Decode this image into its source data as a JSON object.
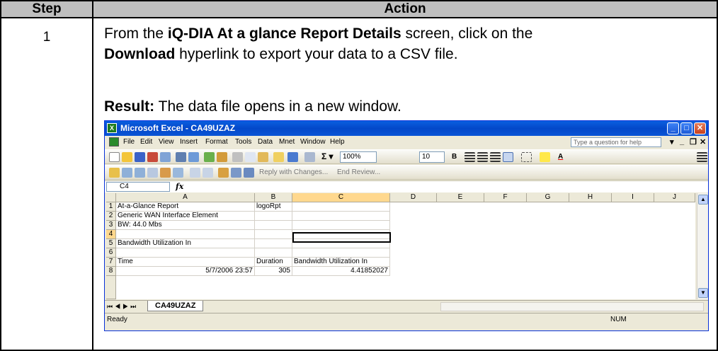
{
  "table": {
    "header_step": "Step",
    "header_action": "Action",
    "step_number": "1",
    "instruction_part1": "From the ",
    "instruction_bold1": "iQ-DIA At a glance Report Details",
    "instruction_part2": " screen, click on the",
    "instruction_bold2": "Download",
    "instruction_part3": " hyperlink to export your data to a CSV file.",
    "result_label": "Result:",
    "result_text": "  The data file opens in a new window."
  },
  "excel": {
    "title": "Microsoft Excel - CA49UZAZ",
    "menu": [
      "File",
      "Edit",
      "View",
      "Insert",
      "Format",
      "Tools",
      "Data",
      "Mnet",
      "Window",
      "Help"
    ],
    "help_placeholder": "Type a question for help",
    "zoom": "100%",
    "font_size": "10",
    "reply_text": "Reply with Changes...",
    "end_review": "End Review...",
    "name_box": "C4",
    "fx": "fx",
    "columns": [
      "A",
      "B",
      "C",
      "D",
      "E",
      "F",
      "G",
      "H",
      "I",
      "J"
    ],
    "rows": [
      {
        "num": "1",
        "A": "At-a-Glance Report",
        "B": "logoRpt",
        "C": ""
      },
      {
        "num": "2",
        "A": "Generic WAN Interface Element",
        "B": "",
        "C": ""
      },
      {
        "num": "3",
        "A": "BW: 44.0 Mbs",
        "B": "",
        "C": ""
      },
      {
        "num": "4",
        "A": "",
        "B": "",
        "C": ""
      },
      {
        "num": "5",
        "A": "Bandwidth Utilization In",
        "B": "",
        "C": ""
      },
      {
        "num": "6",
        "A": "",
        "B": "",
        "C": ""
      },
      {
        "num": "7",
        "A": "Time",
        "B": "Duration",
        "C": "Bandwidth Utilization In"
      },
      {
        "num": "8",
        "A": "5/7/2006 23:57",
        "B": "305",
        "C": "4.41852027"
      }
    ],
    "sheet_tab": "CA49UZAZ",
    "status_ready": "Ready",
    "status_num": "NUM"
  }
}
